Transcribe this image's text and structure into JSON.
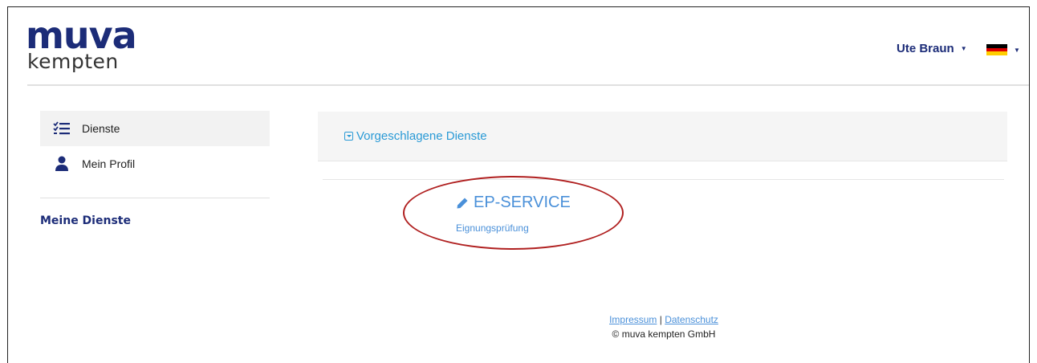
{
  "header": {
    "logo_top": "muva",
    "logo_bottom": "kempten",
    "user_name": "Ute Braun",
    "language_icon": "flag-germany",
    "flag_colors": [
      "#000000",
      "#dd0000",
      "#ffce00"
    ]
  },
  "sidebar": {
    "items": [
      {
        "label": "Dienste",
        "icon": "task-list-icon",
        "active": true
      },
      {
        "label": "Mein Profil",
        "icon": "user-icon",
        "active": false
      }
    ],
    "section_heading": "Meine Dienste"
  },
  "main": {
    "panel_title": "Vorgeschlagene Dienste",
    "service": {
      "title": "EP-SERVICE",
      "subtitle": "Eignungsprüfung",
      "icon": "pencil-icon"
    }
  },
  "footer": {
    "impressum": "Impressum",
    "separator": "|",
    "datenschutz": "Datenschutz",
    "copyright": "© muva kempten GmbH"
  },
  "colors": {
    "brand": "#1c2c78",
    "link": "#2a9ad6",
    "annotation": "#b02020"
  }
}
